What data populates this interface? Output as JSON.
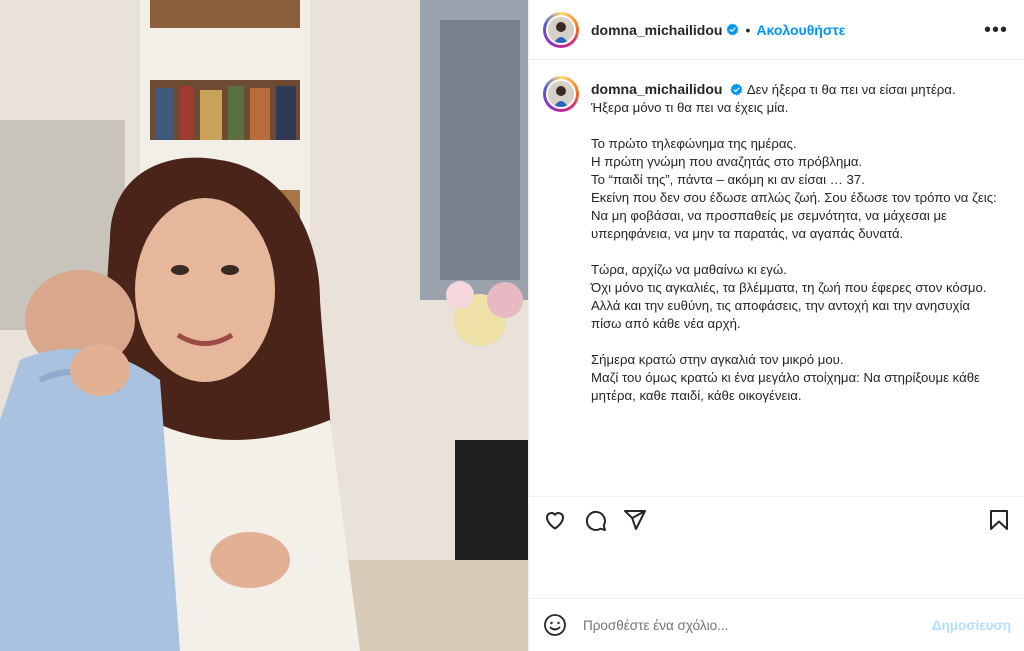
{
  "colors": {
    "accent": "#0095f6",
    "post_disabled": "#b2dffc",
    "verified": "#0095f6",
    "text": "#262626"
  },
  "header": {
    "username": "domna_michailidou",
    "separator": "•",
    "follow_label": "Ακολουθήστε",
    "more_icon": "more-horizontal-icon"
  },
  "caption": {
    "username": "domna_michailidou",
    "paragraphs": [
      [
        "Δεν ήξερα τι θα πει να είσαι μητέρα.",
        "Ήξερα μόνο τι θα πει να έχεις μία."
      ],
      [
        "Το πρώτο τηλεφώνημα της ημέρας.",
        "Η πρώτη γνώμη που αναζητάς στο πρόβλημα.",
        "Το “παιδί της”, πάντα – ακόμη κι αν είσαι … 37.",
        "Εκείνη που δεν σου έδωσε απλώς ζωή. Σου έδωσε τον τρόπο να ζεις:",
        "Να μη φοβάσαι, να προσπαθείς με σεμνότητα, να μάχεσαι με υπερηφάνεια, να μην τα παρατάς, να αγαπάς δυνατά."
      ],
      [
        "Τώρα, αρχίζω να μαθαίνω κι εγώ.",
        "Όχι μόνο τις αγκαλιές, τα βλέμματα, τη ζωή που έφερες στον κόσμο. Αλλά και την ευθύνη, τις αποφάσεις, την αντοχή και την ανησυχία πίσω από κάθε νέα αρχή."
      ],
      [
        "Σήμερα κρατώ στην αγκαλιά τον μικρό μου.",
        "Μαζί του όμως κρατώ κι ένα μεγάλο στοίχημα: Να στηρίξουμε κάθε μητέρα, καθε παιδί, κάθε οικογένεια."
      ]
    ]
  },
  "actions": {
    "icons": [
      "heart-icon",
      "comment-icon",
      "share-icon",
      "bookmark-icon"
    ]
  },
  "comment": {
    "emoji_icon": "emoji-icon",
    "placeholder": "Προσθέστε ένα σχόλιο...",
    "post_label": "Δημοσίευση"
  }
}
